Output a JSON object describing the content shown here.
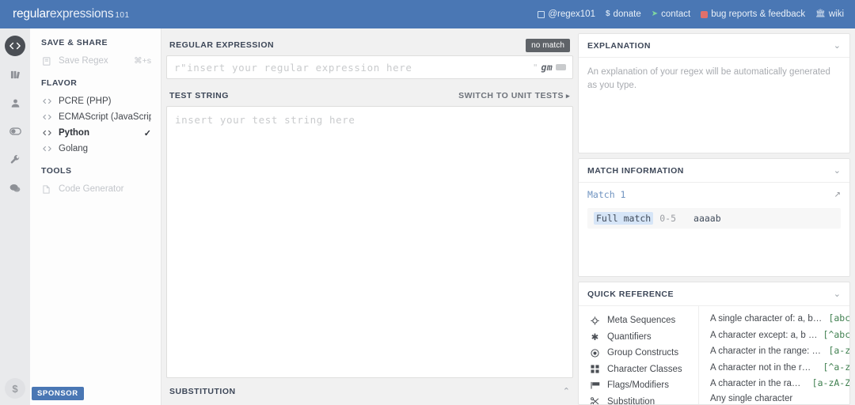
{
  "header": {
    "logo_part1": "regular",
    "logo_part2": "expressions",
    "logo_part3": "101",
    "nav": [
      {
        "label": "@regex101",
        "icon": "twitter-square-icon"
      },
      {
        "label": "donate",
        "icon": "dollar-icon"
      },
      {
        "label": "contact",
        "icon": "paper-plane-icon"
      },
      {
        "label": "bug reports & feedback",
        "icon": "bug-icon"
      },
      {
        "label": "wiki",
        "icon": "bank-icon"
      }
    ]
  },
  "rail": {
    "items": [
      {
        "name": "code-icon"
      },
      {
        "name": "library-icon"
      },
      {
        "name": "account-icon"
      },
      {
        "name": "toggle-icon"
      },
      {
        "name": "wrench-icon"
      },
      {
        "name": "comments-icon"
      }
    ],
    "bottom": {
      "name": "donate-icon",
      "glyph": "$"
    }
  },
  "sidebar": {
    "save_share_title": "SAVE & SHARE",
    "save_regex_label": "Save Regex",
    "save_regex_shortcut": "⌘+s",
    "flavor_title": "FLAVOR",
    "flavors": [
      {
        "label": "PCRE (PHP)",
        "selected": false
      },
      {
        "label": "ECMAScript (JavaScript)",
        "selected": false
      },
      {
        "label": "Python",
        "selected": true
      },
      {
        "label": "Golang",
        "selected": false
      }
    ],
    "tools_title": "TOOLS",
    "code_generator_label": "Code Generator",
    "sponsor_label": "SPONSOR"
  },
  "main": {
    "regex_title": "REGULAR EXPRESSION",
    "match_status": "no match",
    "regex_prefix": "r\"",
    "regex_placeholder": "insert your regular expression here",
    "regex_quote": "\"",
    "regex_flags": "gm",
    "test_string_title": "TEST STRING",
    "switch_unit_tests": "SWITCH TO UNIT TESTS",
    "switch_arrow": "▸",
    "test_string_placeholder": "insert your test string here",
    "substitution_title": "SUBSTITUTION",
    "substitution_chevron": "⌃"
  },
  "explanation": {
    "title": "EXPLANATION",
    "text": "An explanation of your regex will be automatically generated as you type."
  },
  "match_information": {
    "title": "MATCH INFORMATION",
    "match_label": "Match 1",
    "full_match_label": "Full match",
    "range": "0-5",
    "value": "aaaab"
  },
  "quick_reference": {
    "title": "QUICK REFERENCE",
    "categories": [
      {
        "label": "Meta Sequences",
        "icon": "compass-icon",
        "glyph": "✣"
      },
      {
        "label": "Quantifiers",
        "icon": "asterisk-icon",
        "glyph": "✱"
      },
      {
        "label": "Group Constructs",
        "icon": "target-icon",
        "glyph": "◉"
      },
      {
        "label": "Character Classes",
        "icon": "grid-icon",
        "glyph": "█"
      },
      {
        "label": "Flags/Modifiers",
        "icon": "flag-icon",
        "glyph": "⚑"
      },
      {
        "label": "Substitution",
        "icon": "scissors-icon",
        "glyph": "✂"
      }
    ],
    "entries": [
      {
        "desc": "A single character of: a, b…",
        "code": "[abc]"
      },
      {
        "desc": "A character except: a, b …",
        "code": "[^abc]"
      },
      {
        "desc": "A character in the range: …",
        "code": "[a-z]"
      },
      {
        "desc": "A character not in the r…",
        "code": "[^a-z]"
      },
      {
        "desc": "A character in the ra…",
        "code": "[a-zA-Z]"
      },
      {
        "desc": "Any single character",
        "code": ""
      }
    ]
  },
  "colors": {
    "brand": "#4a77b4",
    "accent_green": "#3f7f4f",
    "match_highlight": "#d6e5f7",
    "status_badge": "#5f6368"
  }
}
